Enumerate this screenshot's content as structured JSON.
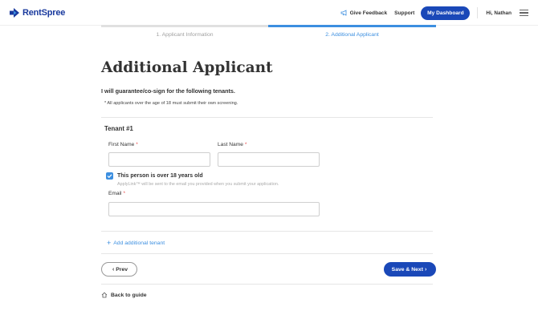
{
  "brand": {
    "name": "RentSpree",
    "color": "#1a3a9e"
  },
  "header": {
    "feedback_label": "Give Feedback",
    "support_label": "Support",
    "dashboard_label": "My Dashboard",
    "greeting": "Hi, Nathan"
  },
  "steps": [
    {
      "label": "1. Applicant Information",
      "active": false
    },
    {
      "label": "2. Additional Applicant",
      "active": true
    }
  ],
  "page": {
    "title": "Additional Applicant",
    "guarantee_text": "I will guarantee/co-sign for the following tenants.",
    "note": "* All applicants over the age of 18 must submit their own screening."
  },
  "tenant": {
    "title": "Tenant #1",
    "first_name_label": "First Name",
    "last_name_label": "Last Name",
    "required_mark": "*",
    "first_name_value": "",
    "last_name_value": "",
    "over18_checked": true,
    "over18_label": "This person is over 18 years old",
    "over18_help": "ApplyLink™ will be sent to the email you provided when you submit your application.",
    "email_label": "Email",
    "email_value": ""
  },
  "actions": {
    "add_tenant": "Add additional tenant",
    "prev": "Prev",
    "next": "Save & Next",
    "back_to_guide": "Back to guide"
  },
  "colors": {
    "primary": "#1a48b8",
    "accent": "#3c8fe0",
    "required": "#e84c4c"
  }
}
